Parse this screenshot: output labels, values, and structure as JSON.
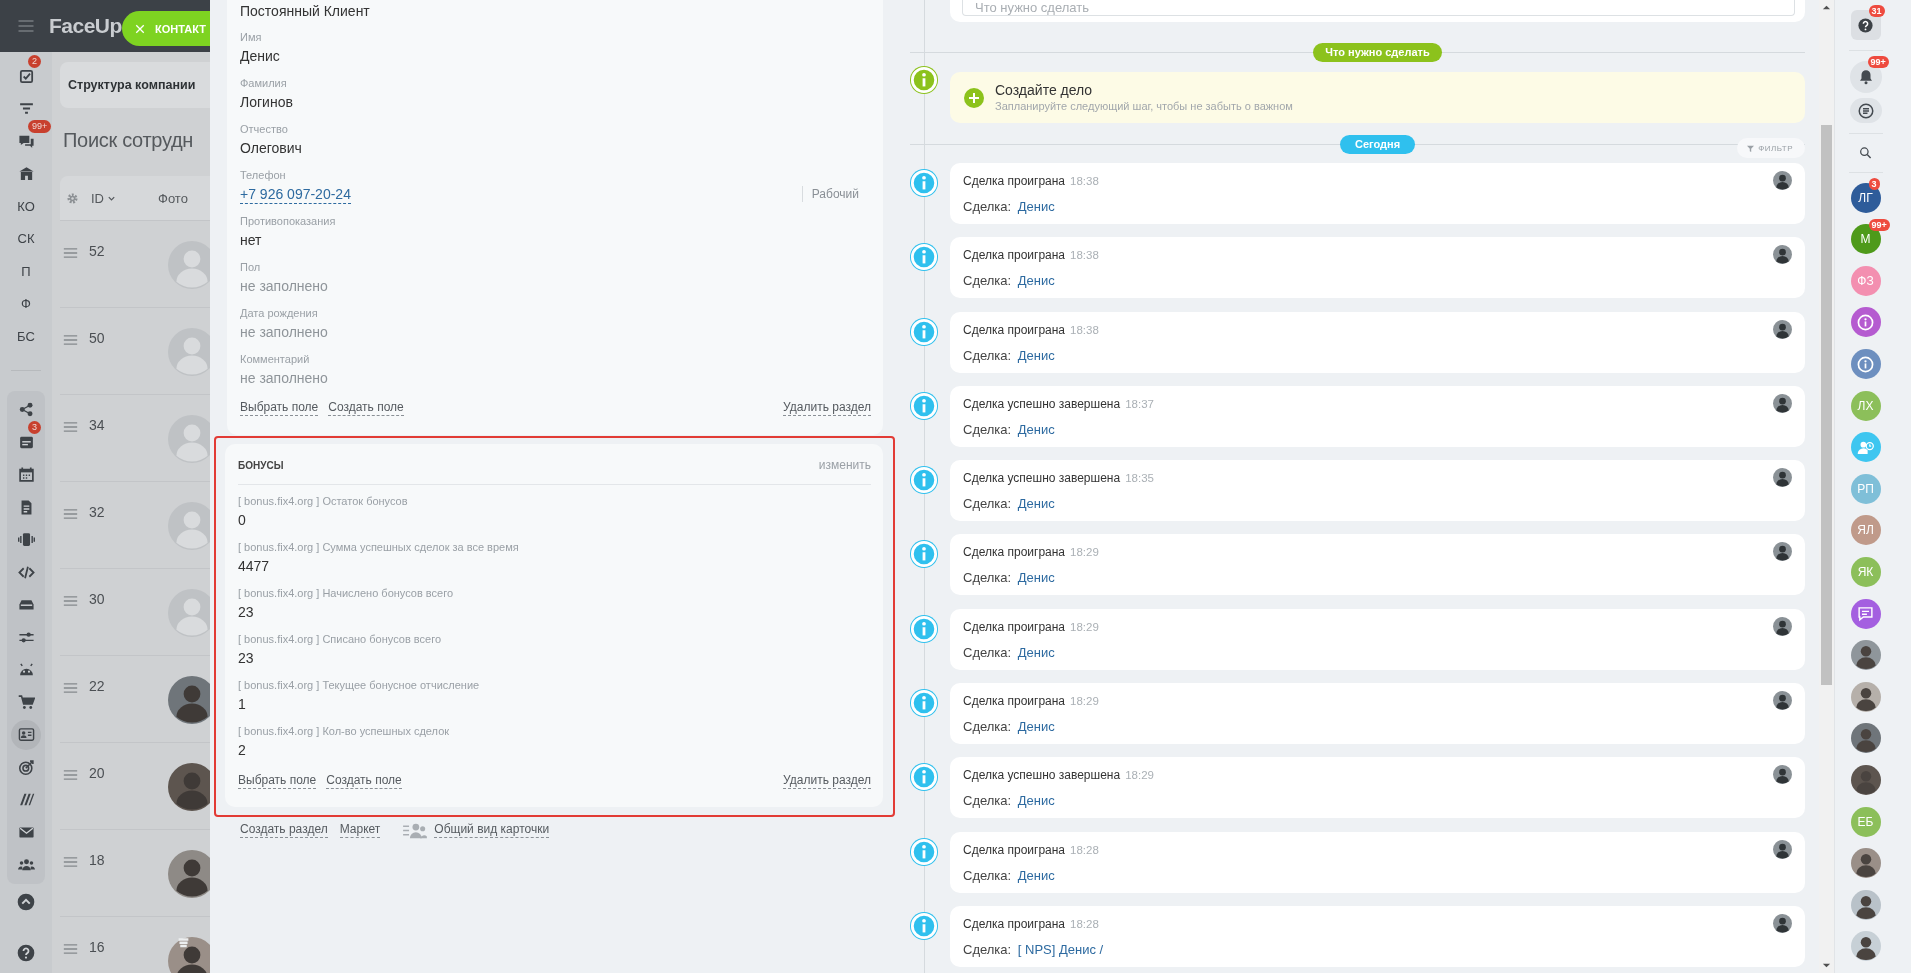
{
  "page": {
    "logo": "FaceUp",
    "nav_top": [
      {
        "kind": "icon",
        "badge": "2",
        "selected": false
      },
      {
        "kind": "icon",
        "selected": false
      },
      {
        "kind": "icon",
        "badge": "99+",
        "selected": false
      },
      {
        "kind": "icon",
        "selected": false
      },
      {
        "kind": "text",
        "label": "КО",
        "selected": false
      },
      {
        "kind": "text",
        "label": "СК",
        "selected": false
      },
      {
        "kind": "text",
        "label": "П",
        "selected": false
      },
      {
        "kind": "text",
        "label": "Ф",
        "selected": false
      },
      {
        "kind": "text",
        "label": "БС",
        "selected": false
      }
    ],
    "nav_tools": [
      {
        "selected": false
      },
      {
        "badge": "3",
        "selected": false
      },
      {
        "selected": false
      },
      {
        "selected": false
      },
      {
        "selected": false
      },
      {
        "selected": false
      },
      {
        "selected": false
      },
      {
        "selected": false
      },
      {
        "selected": false
      },
      {
        "selected": false
      },
      {
        "selected": true
      },
      {
        "selected": false
      },
      {
        "selected": false
      },
      {
        "selected": false
      },
      {
        "selected": false
      }
    ],
    "tab": "Структура компании",
    "title": "Поиск сотрудн",
    "table": {
      "columns": [
        "ID",
        "Фото"
      ],
      "rows": [
        {
          "id": "52",
          "kind": "default"
        },
        {
          "id": "50",
          "kind": "default"
        },
        {
          "id": "34",
          "kind": "default"
        },
        {
          "id": "32",
          "kind": "default"
        },
        {
          "id": "30",
          "kind": "default"
        },
        {
          "id": "22",
          "kind": "photo"
        },
        {
          "id": "20",
          "kind": "photo"
        },
        {
          "id": "18",
          "kind": "photo"
        },
        {
          "id": "16",
          "kind": "photo"
        }
      ]
    }
  },
  "close_button": {
    "label": "КОНТАКТ"
  },
  "contact_card": {
    "status": "Постоянный Клиент",
    "fields": [
      {
        "label": "Имя",
        "value": "Денис",
        "kind": "text",
        "empty": false
      },
      {
        "label": "Фамилия",
        "value": "Логинов",
        "kind": "text",
        "empty": false
      },
      {
        "label": "Отчество",
        "value": "Олегович",
        "kind": "text",
        "empty": false
      },
      {
        "label": "Телефон",
        "value": "+7 926 097-20-24",
        "kind": "phone",
        "phone_type": "Рабочий",
        "empty": false
      },
      {
        "label": "Противопоказания",
        "value": "нет",
        "kind": "text",
        "empty": false
      },
      {
        "label": "Пол",
        "value": "не заполнено",
        "kind": "text",
        "empty": true
      },
      {
        "label": "Дата рождения",
        "value": "не заполнено",
        "kind": "text",
        "empty": true
      },
      {
        "label": "Комментарий",
        "value": "не заполнено",
        "kind": "text",
        "empty": true
      }
    ],
    "actions": [
      "Выбрать поле",
      "Создать поле"
    ],
    "delete_label": "Удалить раздел"
  },
  "bonus_section": {
    "title": "БОНУСЫ",
    "edit_label": "изменить",
    "highlighted": true,
    "fields": [
      {
        "label": "[ bonus.fix4.org ] Остаток бонусов",
        "value": "0"
      },
      {
        "label": "[ bonus.fix4.org ] Сумма успешных сделок за все время",
        "value": "4477"
      },
      {
        "label": "[ bonus.fix4.org ] Начислено бонусов всего",
        "value": "23"
      },
      {
        "label": "[ bonus.fix4.org ] Списано бонусов всего",
        "value": "23"
      },
      {
        "label": "[ bonus.fix4.org ] Текущее бонусное отчисление",
        "value": "1"
      },
      {
        "label": "[ bonus.fix4.org ] Кол-во успешных сделок",
        "value": "2"
      }
    ],
    "actions": [
      "Выбрать поле",
      "Создать поле"
    ],
    "delete_label": "Удалить раздел"
  },
  "footer_links": [
    {
      "label": "Создать раздел",
      "kind": "link"
    },
    {
      "label": "Маркет",
      "kind": "link"
    },
    {
      "label": "Общий вид карточки",
      "kind": "icon_link"
    }
  ],
  "timeline": {
    "task_input": {
      "placeholder": "Что нужно сделать"
    },
    "todo_divider": "Что нужно сделать",
    "create_task": {
      "title": "Создайте дело",
      "subtitle": "Запланируйте следующий шаг, чтобы не забыть о важном"
    },
    "today_divider": "Сегодня",
    "filter_label": "ФИЛЬТР",
    "events": [
      {
        "title": "Сделка проиграна",
        "time": "18:38",
        "label": "Сделка:",
        "link": "Денис"
      },
      {
        "title": "Сделка проиграна",
        "time": "18:38",
        "label": "Сделка:",
        "link": "Денис"
      },
      {
        "title": "Сделка проиграна",
        "time": "18:38",
        "label": "Сделка:",
        "link": "Денис"
      },
      {
        "title": "Сделка успешно завершена",
        "time": "18:37",
        "label": "Сделка:",
        "link": "Денис"
      },
      {
        "title": "Сделка успешно завершена",
        "time": "18:35",
        "label": "Сделка:",
        "link": "Денис"
      },
      {
        "title": "Сделка проиграна",
        "time": "18:29",
        "label": "Сделка:",
        "link": "Денис"
      },
      {
        "title": "Сделка проиграна",
        "time": "18:29",
        "label": "Сделка:",
        "link": "Денис"
      },
      {
        "title": "Сделка проиграна",
        "time": "18:29",
        "label": "Сделка:",
        "link": "Денис"
      },
      {
        "title": "Сделка успешно завершена",
        "time": "18:29",
        "label": "Сделка:",
        "link": "Денис"
      },
      {
        "title": "Сделка проиграна",
        "time": "18:28",
        "label": "Сделка:",
        "link": "Денис"
      },
      {
        "title": "Сделка проиграна",
        "time": "18:28",
        "label": "Сделка:",
        "link": "[ NPS] Денис /"
      }
    ]
  },
  "right_sidebar": {
    "help_badge": "31",
    "notifications_badge": "99+",
    "contacts": [
      {
        "kind": "initials",
        "text": "ЛГ",
        "color": "#2e5c9a",
        "badge": "3"
      },
      {
        "kind": "initials",
        "text": "М",
        "color": "#4e9a1a",
        "badge": "99+"
      },
      {
        "kind": "initials",
        "text": "ФЗ",
        "color": "#f38fb0"
      },
      {
        "kind": "icon",
        "color": "#b55bd0"
      },
      {
        "kind": "icon",
        "color": "#6d8fbf"
      },
      {
        "kind": "initials",
        "text": "ЛХ",
        "color": "#8cbf5a"
      },
      {
        "kind": "icon",
        "color": "#3ec6f0"
      },
      {
        "kind": "initials",
        "text": "РП",
        "color": "#7fbfd8"
      },
      {
        "kind": "initials",
        "text": "ЯЛ",
        "color": "#c09a8a"
      },
      {
        "kind": "initials",
        "text": "ЯК",
        "color": "#8cbf5a"
      },
      {
        "kind": "icon",
        "color": "#a45fe0"
      },
      {
        "kind": "photo"
      },
      {
        "kind": "photo"
      },
      {
        "kind": "photo"
      },
      {
        "kind": "photo"
      },
      {
        "kind": "initials",
        "text": "ЕБ",
        "color": "#8cbf5a"
      },
      {
        "kind": "photo"
      },
      {
        "kind": "photo"
      },
      {
        "kind": "photo"
      }
    ]
  }
}
